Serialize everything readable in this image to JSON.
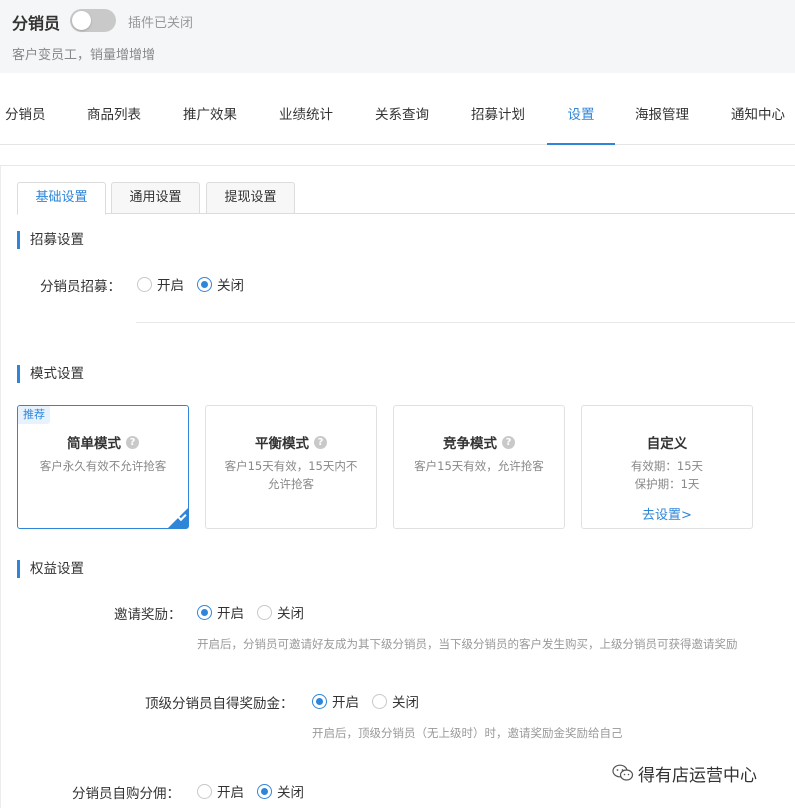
{
  "header": {
    "title": "分销员",
    "toggle_status": "插件已关闭",
    "subtitle": "客户变员工，销量增增增"
  },
  "nav": {
    "tabs": [
      {
        "label": "分销员"
      },
      {
        "label": "商品列表"
      },
      {
        "label": "推广效果"
      },
      {
        "label": "业绩统计"
      },
      {
        "label": "关系查询"
      },
      {
        "label": "招募计划"
      },
      {
        "label": "设置"
      },
      {
        "label": "海报管理"
      },
      {
        "label": "通知中心"
      }
    ],
    "active": "设置"
  },
  "subtabs": {
    "items": [
      {
        "label": "基础设置"
      },
      {
        "label": "通用设置"
      },
      {
        "label": "提现设置"
      }
    ],
    "active": "基础设置"
  },
  "recruit": {
    "section_title": "招募设置",
    "field_label": "分销员招募：",
    "options": [
      "开启",
      "关闭"
    ],
    "selected": "关闭"
  },
  "mode": {
    "section_title": "模式设置",
    "cards": [
      {
        "badge": "推荐",
        "title": "简单模式",
        "desc": "客户永久有效不允许抢客",
        "selected": true
      },
      {
        "title": "平衡模式",
        "desc": "客户15天有效，15天内不允许抢客"
      },
      {
        "title": "竞争模式",
        "desc": "客户15天有效，允许抢客"
      },
      {
        "title": "自定义",
        "desc_line1": "有效期：15天",
        "desc_line2": "保护期：1天",
        "link": "去设置>"
      }
    ]
  },
  "rights": {
    "section_title": "权益设置",
    "invite_reward": {
      "label": "邀请奖励：",
      "options": [
        "开启",
        "关闭"
      ],
      "selected": "开启",
      "hint": "开启后，分销员可邀请好友成为其下级分销员，当下级分销员的客户发生购买，上级分销员可获得邀请奖励"
    },
    "top_reward": {
      "label": "顶级分销员自得奖励金：",
      "options": [
        "开启",
        "关闭"
      ],
      "selected": "开启",
      "hint": "开启后，顶级分销员（无上级时）时，邀请奖励金奖励给自己"
    },
    "self_commission": {
      "label": "分销员自购分佣：",
      "options": [
        "开启",
        "关闭"
      ],
      "selected": "关闭"
    }
  },
  "watermark": {
    "text": "得有店运营中心",
    "icon": "wechat-icon"
  },
  "colors": {
    "accent": "#2f86d9",
    "header_bg": "#f5f6f7"
  }
}
